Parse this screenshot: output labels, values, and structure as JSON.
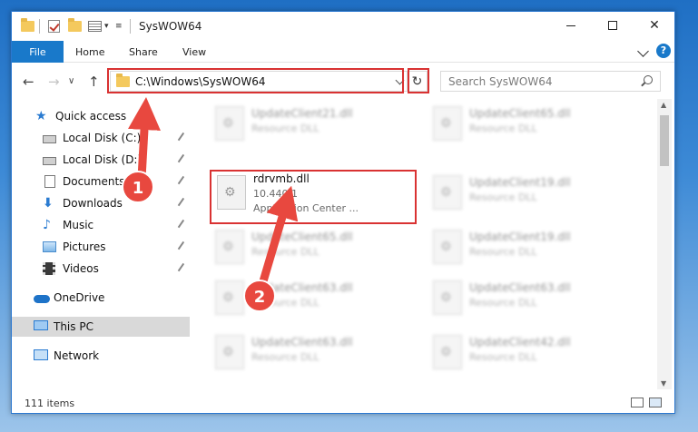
{
  "window": {
    "title": "SysWOW64",
    "controls": {
      "minimize": "minimize-icon",
      "maximize": "maximize-icon",
      "close": "close-icon"
    }
  },
  "ribbon": {
    "tabs": [
      "File",
      "Home",
      "Share",
      "View"
    ],
    "help": "?"
  },
  "address_bar": {
    "path": "C:\\Windows\\SysWOW64",
    "refresh_icon": "refresh-icon"
  },
  "search": {
    "placeholder": "Search SysWOW64"
  },
  "sidebar": {
    "items": [
      {
        "label": "Quick access",
        "icon": "star-icon",
        "pinned": false
      },
      {
        "label": "Local Disk (C:)",
        "icon": "disk-icon",
        "pinned": true
      },
      {
        "label": "Local Disk (D:)",
        "icon": "disk-icon",
        "pinned": true
      },
      {
        "label": "Documents",
        "icon": "documents-icon",
        "pinned": true
      },
      {
        "label": "Downloads",
        "icon": "downloads-icon",
        "pinned": true
      },
      {
        "label": "Music",
        "icon": "music-icon",
        "pinned": true
      },
      {
        "label": "Pictures",
        "icon": "pictures-icon",
        "pinned": true
      },
      {
        "label": "Videos",
        "icon": "videos-icon",
        "pinned": true
      },
      {
        "label": "OneDrive",
        "icon": "onedrive-icon",
        "pinned": false
      },
      {
        "label": "This PC",
        "icon": "this-pc-icon",
        "pinned": false,
        "selected": true
      },
      {
        "label": "Network",
        "icon": "network-icon",
        "pinned": false
      }
    ]
  },
  "files": {
    "left": [
      {
        "name": "UpdateClient21.dll",
        "sub": "Resource DLL",
        "blurred": true
      },
      {
        "name": "rdrvmb.dll",
        "sub": "10.440.1",
        "sub2": "Application Center ...",
        "blurred": false,
        "highlighted": true
      },
      {
        "name": "UpdateClient65.dll",
        "sub": "Resource DLL",
        "blurred": true
      },
      {
        "name": "UpdateClient63.dll",
        "sub": "Resource DLL",
        "blurred": true
      },
      {
        "name": "UpdateClient63.dll",
        "sub": "Resource DLL",
        "blurred": true
      }
    ],
    "right": [
      {
        "name": "UpdateClient65.dll",
        "sub": "Resource DLL",
        "blurred": true
      },
      {
        "name": "UpdateClient19.dll",
        "sub": "Resource DLL",
        "blurred": true
      },
      {
        "name": "UpdateClient19.dll",
        "sub": "Resource DLL",
        "blurred": true
      },
      {
        "name": "UpdateClient63.dll",
        "sub": "Resource DLL",
        "blurred": true
      },
      {
        "name": "UpdateClient42.dll",
        "sub": "Resource DLL",
        "blurred": true
      }
    ]
  },
  "status_bar": {
    "item_count": "111 items"
  },
  "annotations": [
    {
      "number": "1",
      "color": "#e8483f"
    },
    {
      "number": "2",
      "color": "#e8483f"
    }
  ],
  "colors": {
    "accent": "#1979ca",
    "highlight": "#d93232",
    "badge": "#e8483f"
  }
}
